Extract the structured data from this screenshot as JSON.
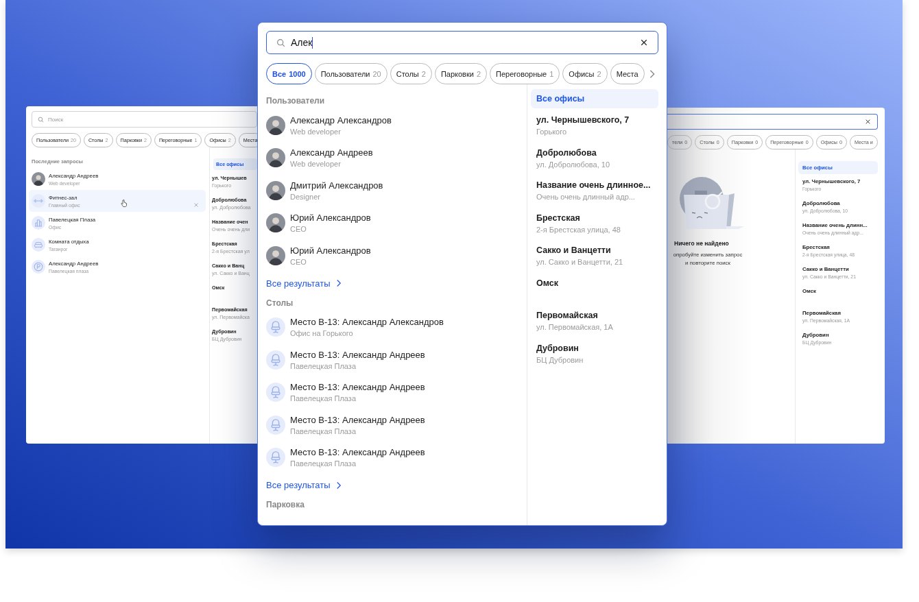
{
  "left_window": {
    "search": {
      "placeholder": "Поиск"
    },
    "chips": [
      {
        "label": "Пользователи",
        "count": "20"
      },
      {
        "label": "Столы",
        "count": "2"
      },
      {
        "label": "Парковки",
        "count": "2"
      },
      {
        "label": "Переговорные",
        "count": "1"
      },
      {
        "label": "Офисы",
        "count": "2"
      },
      {
        "label": "Места"
      }
    ],
    "recent": {
      "title": "Последние запросы",
      "items": [
        {
          "kind": "user",
          "title": "Александр Андреев",
          "subtitle": "Web developer",
          "hovered": false
        },
        {
          "kind": "gym",
          "title": "Фитнес-зал",
          "subtitle": "Главный офис",
          "hovered": true
        },
        {
          "kind": "office",
          "title": "Павелецкая Плаза",
          "subtitle": "Офис",
          "hovered": false
        },
        {
          "kind": "lounge",
          "title": "Комната отдыха",
          "subtitle": "Таганрог",
          "hovered": false
        },
        {
          "kind": "parking",
          "title": "Александр Андреев",
          "subtitle": "Павелецкая плаза",
          "hovered": false
        }
      ]
    },
    "offices": [
      {
        "title": "Все офисы",
        "selected": true
      },
      {
        "title": "ул. Чернышев",
        "subtitle": "Горького",
        "selected": false
      },
      {
        "title": "Добролюбова",
        "subtitle": "ул. Добролюбова",
        "selected": false
      },
      {
        "title": "Название очен",
        "subtitle": "Очень очень дли",
        "selected": false
      },
      {
        "title": "Брестская",
        "subtitle": "2-я Брестская ул",
        "selected": false
      },
      {
        "title": "Сакко и Ванц",
        "subtitle": "ул. Сакко и Ванц",
        "selected": false
      },
      {
        "title": "Омск",
        "selected": false
      },
      {
        "title": "Первомайская",
        "subtitle": "ул. Первомайска",
        "selected": false
      },
      {
        "title": "Дубровин",
        "subtitle": "БЦ Дубровин",
        "selected": false
      }
    ]
  },
  "main_window": {
    "search": {
      "value": "Алек"
    },
    "chips": [
      {
        "label": "Все",
        "count": "1000",
        "selected": true
      },
      {
        "label": "Пользователи",
        "count": "20",
        "selected": false
      },
      {
        "label": "Столы",
        "count": "2",
        "selected": false
      },
      {
        "label": "Парковки",
        "count": "2",
        "selected": false
      },
      {
        "label": "Переговорные",
        "count": "1",
        "selected": false
      },
      {
        "label": "Офисы",
        "count": "2",
        "selected": false
      },
      {
        "label": "Места",
        "selected": false
      }
    ],
    "sections": [
      {
        "title": "Пользователи",
        "more": "Все результаты",
        "items": [
          {
            "kind": "user",
            "title": "Александр Александров",
            "subtitle": "Web developer"
          },
          {
            "kind": "user",
            "title": "Александр Андреев",
            "subtitle": "Web developer"
          },
          {
            "kind": "user",
            "title": "Дмитрий Александров",
            "subtitle": "Designer"
          },
          {
            "kind": "user",
            "title": "Юрий Александров",
            "subtitle": "CEO"
          },
          {
            "kind": "user",
            "title": "Юрий Александров",
            "subtitle": "CEO"
          }
        ]
      },
      {
        "title": "Столы",
        "more": "Все результаты",
        "items": [
          {
            "kind": "desk",
            "title": "Место B-13: Александр Александров",
            "subtitle": "Офис на Горького"
          },
          {
            "kind": "desk",
            "title": "Место B-13: Александр Андреев",
            "subtitle": "Павелецкая Плаза"
          },
          {
            "kind": "desk",
            "title": "Место B-13: Александр Андреев",
            "subtitle": "Павелецкая Плаза"
          },
          {
            "kind": "desk",
            "title": "Место B-13: Александр Андреев",
            "subtitle": "Павелецкая Плаза"
          },
          {
            "kind": "desk",
            "title": "Место B-13: Александр Андреев",
            "subtitle": "Павелецкая Плаза"
          }
        ]
      },
      {
        "title": "Парковка"
      }
    ],
    "offices": [
      {
        "title": "Все офисы",
        "selected": true
      },
      {
        "title": "ул. Чернышевского, 7",
        "subtitle": "Горького",
        "selected": false
      },
      {
        "title": "Добролюбова",
        "subtitle": "ул. Добролюбова, 10",
        "selected": false
      },
      {
        "title": "Название очень длинное...",
        "subtitle": "Очень очень длинный адр...",
        "selected": false
      },
      {
        "title": "Брестская",
        "subtitle": "2-я Брестская улица, 48",
        "selected": false
      },
      {
        "title": "Сакко и Ванцетти",
        "subtitle": "ул. Сакко и Ванцетти, 21",
        "selected": false
      },
      {
        "title": "Омск",
        "selected": false
      },
      {
        "title": "Первомайская",
        "subtitle": "ул. Первомайская, 1А",
        "selected": false
      },
      {
        "title": "Дубровин",
        "subtitle": "БЦ Дубровин",
        "selected": false
      }
    ]
  },
  "right_window": {
    "chips": [
      {
        "label": "тели",
        "count": "0"
      },
      {
        "label": "Столы",
        "count": "0"
      },
      {
        "label": "Парковки",
        "count": "0"
      },
      {
        "label": "Переговорные",
        "count": "0"
      },
      {
        "label": "Офисы",
        "count": "0"
      },
      {
        "label": "Места и"
      }
    ],
    "empty": {
      "title": "Ничего не найдено",
      "lines": [
        "опробуйте изменить запрос",
        "и повторите поиск"
      ]
    },
    "offices": [
      {
        "title": "Все офисы",
        "selected": true
      },
      {
        "title": "ул. Чернышевского, 7",
        "subtitle": "Горького",
        "selected": false
      },
      {
        "title": "Добролюбова",
        "subtitle": "ул. Добролюбова, 10",
        "selected": false
      },
      {
        "title": "Название очень длинн...",
        "subtitle": "Очень очень длинный адр...",
        "selected": false
      },
      {
        "title": "Брестская",
        "subtitle": "2-я Брестская улица, 48",
        "selected": false
      },
      {
        "title": "Сакко и Ванцетти",
        "subtitle": "ул. Сакко и Ванцетти, 21",
        "selected": false
      },
      {
        "title": "Омск",
        "selected": false
      },
      {
        "title": "Первомайская",
        "subtitle": "ул. Первомайская, 1А",
        "selected": false
      },
      {
        "title": "Дубровин",
        "subtitle": "БЦ Дубровин",
        "selected": false
      }
    ]
  }
}
